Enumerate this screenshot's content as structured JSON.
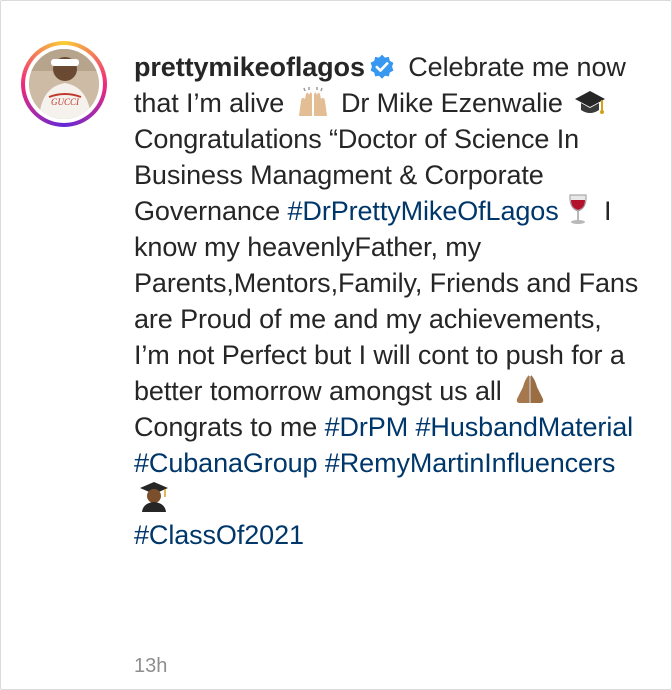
{
  "post": {
    "username": "prettymikeoflagos",
    "caption": {
      "t1": " Celebrate me now that I’m alive ",
      "t2": " Dr Mike Ezenwalie ",
      "t3": "Congratulations “Doctor of Science In Business Managment & Corporate Governance ",
      "h1": "#DrPrettyMikeOfLagos",
      "t4": " I know my heavenlyFather, my Parents,Mentors,Family, Friends and Fans are Proud of me and my achievements, I’m not Perfect but I will cont to push for a better tomorrow amongst us all ",
      "t5": " Congrats to me ",
      "h2": "#DrPM",
      "h3": "#HusbandMaterial",
      "h4": "#CubanaGroup",
      "h5": "#RemyMartinInfluencers",
      "h6": "#ClassOf2021"
    },
    "timestamp": "13h",
    "avatar_text": "GUCCI"
  },
  "icons": {
    "verified": "verified-badge-icon",
    "praise": "raising-hands-emoji",
    "cap": "graduation-cap-emoji",
    "wine": "wine-glass-emoji",
    "pray": "folded-hands-emoji",
    "graduate": "graduate-emoji"
  },
  "colors": {
    "text": "#262626",
    "hashtag": "#00376b",
    "verified": "#3897f0",
    "timestamp": "#8e8e8e"
  }
}
